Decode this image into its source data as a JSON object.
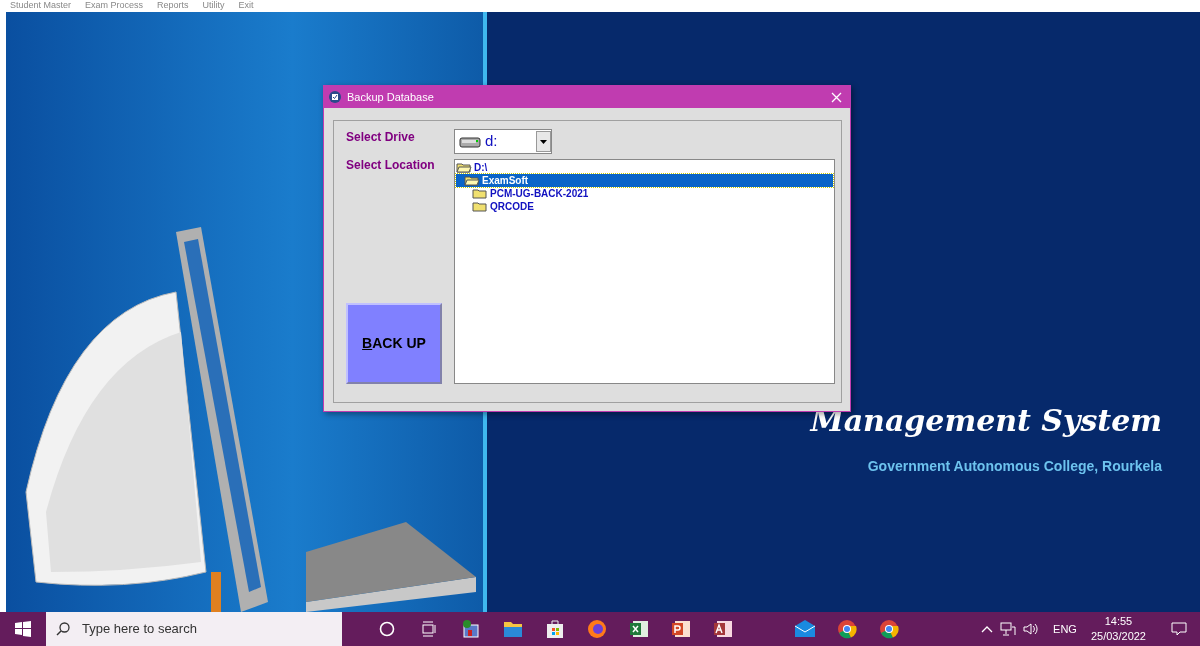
{
  "menu": [
    "Student Master",
    "Exam Process",
    "Reports",
    "Utility",
    "Exit"
  ],
  "app": {
    "title": "Management System",
    "subtitle": "Government Autonomous College, Rourkela"
  },
  "dialog": {
    "title": "Backup Database",
    "drive_label": "Select Drive",
    "drive_value": "d:",
    "location_label": "Select Location",
    "button": "BACK UP",
    "tree": [
      {
        "label": "D:\\",
        "expanded": true,
        "selected": false,
        "children": [
          {
            "label": "ExamSoft",
            "expanded": true,
            "selected": true,
            "children": [
              {
                "label": "PCM-UG-BACK-2021",
                "expanded": false,
                "selected": false
              },
              {
                "label": "QRCODE",
                "expanded": false,
                "selected": false
              }
            ]
          }
        ]
      }
    ]
  },
  "taskbar": {
    "search": {
      "placeholder": "Type here to search"
    },
    "language": "ENG",
    "time": "14:55",
    "date": "25/03/2022"
  }
}
